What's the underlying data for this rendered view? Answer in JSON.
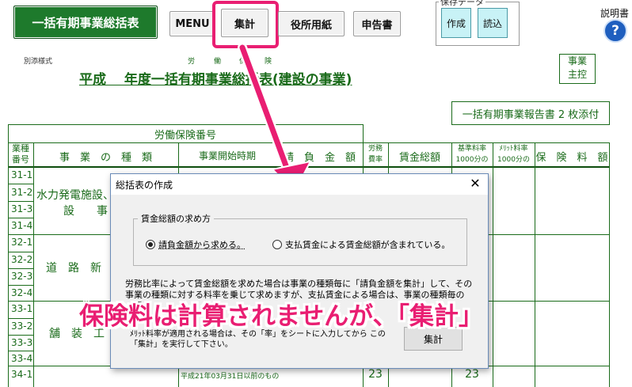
{
  "toolbar": {
    "title_button": "一括有期事業総括表",
    "menu_button": "MENU",
    "aggregate_button": "集計",
    "office_form_button": "役所用紙",
    "declaration_button": "申告書",
    "data_group_label": "保存データ",
    "create_button": "作成",
    "load_button": "読込",
    "help_label": "説明書",
    "help_icon_glyph": "?"
  },
  "form": {
    "form_note": "別添様式",
    "ruby": [
      "労",
      "働",
      "保",
      "険"
    ],
    "title": "平成　 年度一括有期事業総括表(建設の事業)",
    "business_owner_box": [
      "事業",
      "主控"
    ],
    "attachment_box": "一括有期事業報告書 2 枚添付",
    "insurance_number_label": "労働保険番号",
    "headers": {
      "type_code": [
        "業種",
        "番号"
      ],
      "business_type": "事　業　の　種　類",
      "period": "事業開始時期",
      "contract_amount": "請　負　金　額",
      "labor_ratio": [
        "労務",
        "費率"
      ],
      "total_wages": "賃金総額",
      "base_rate": [
        "基準料率",
        "1000分の"
      ],
      "merit_rate": [
        "ﾒﾘｯﾄ料率",
        "1000分の"
      ],
      "premium": "保　険　料　額"
    },
    "row_codes": [
      "31-1",
      "31-2",
      "31-3",
      "31-4",
      "32-1",
      "32-2",
      "32-3",
      "32-4",
      "33-1",
      "33-2",
      "33-3",
      "33-4",
      "34-1"
    ],
    "type_group_1": [
      "水力発電施設、",
      "設　　事"
    ],
    "type_group_2": "道　路　新",
    "type_group_3": "舗　装　工",
    "row_34_period": "平成21年03月31日以前のもの",
    "row_34_ratio": "23",
    "row_34_rate": "23"
  },
  "dialog": {
    "title": "総括表の作成",
    "close_glyph": "✕",
    "group_label": "賃金総額の求め方",
    "option_1": "請負金額から求める。",
    "option_2": "支払賃金による賃金総額が含まれている。",
    "selected_option": "option_1",
    "explanation": "労務比率によって賃金総額を求めた場合は事業の種類毎に「請負金額を集計」して、その事業の種類に対する料率を乗じて求めますが、支払賃金による場合は、事業の種類毎の「賃金",
    "note": "ﾒﾘｯﾄ料率が適用される場合は、その「率」をシートに入力してから この「集計」を実行して下さい。",
    "execute_button": "集計"
  },
  "annotation": {
    "callout": "保険料は計算されませんが、「集計」",
    "accent_color": "#e91e72"
  }
}
